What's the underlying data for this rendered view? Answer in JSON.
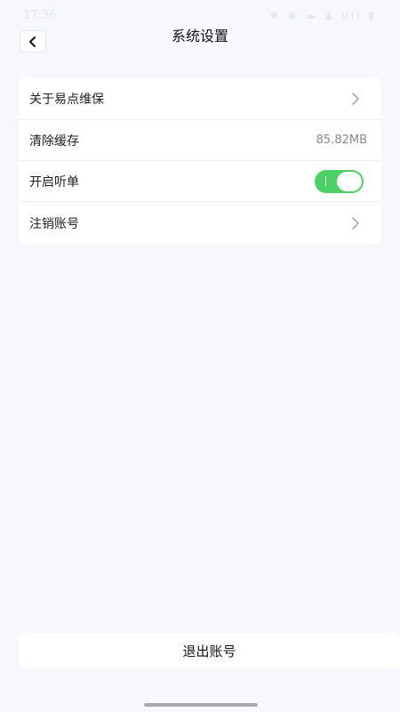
{
  "status_bar": {
    "time": "17:36",
    "icons": "✱ ◉ ☁ ▲ ull ▮"
  },
  "header": {
    "title": "系统设置",
    "back_icon": "chevron-left-icon"
  },
  "settings": {
    "items": [
      {
        "label": "关于易点维保",
        "accessory": "chevron"
      },
      {
        "label": "清除缓存",
        "value": "85.82MB"
      },
      {
        "label": "开启听单",
        "accessory": "toggle",
        "toggle_on": true
      },
      {
        "label": "注销账号",
        "accessory": "chevron"
      }
    ]
  },
  "footer": {
    "logout_label": "退出账号"
  },
  "colors": {
    "background": "#f6f8fd",
    "toggle_on": "#4cd068",
    "card": "#ffffff"
  }
}
